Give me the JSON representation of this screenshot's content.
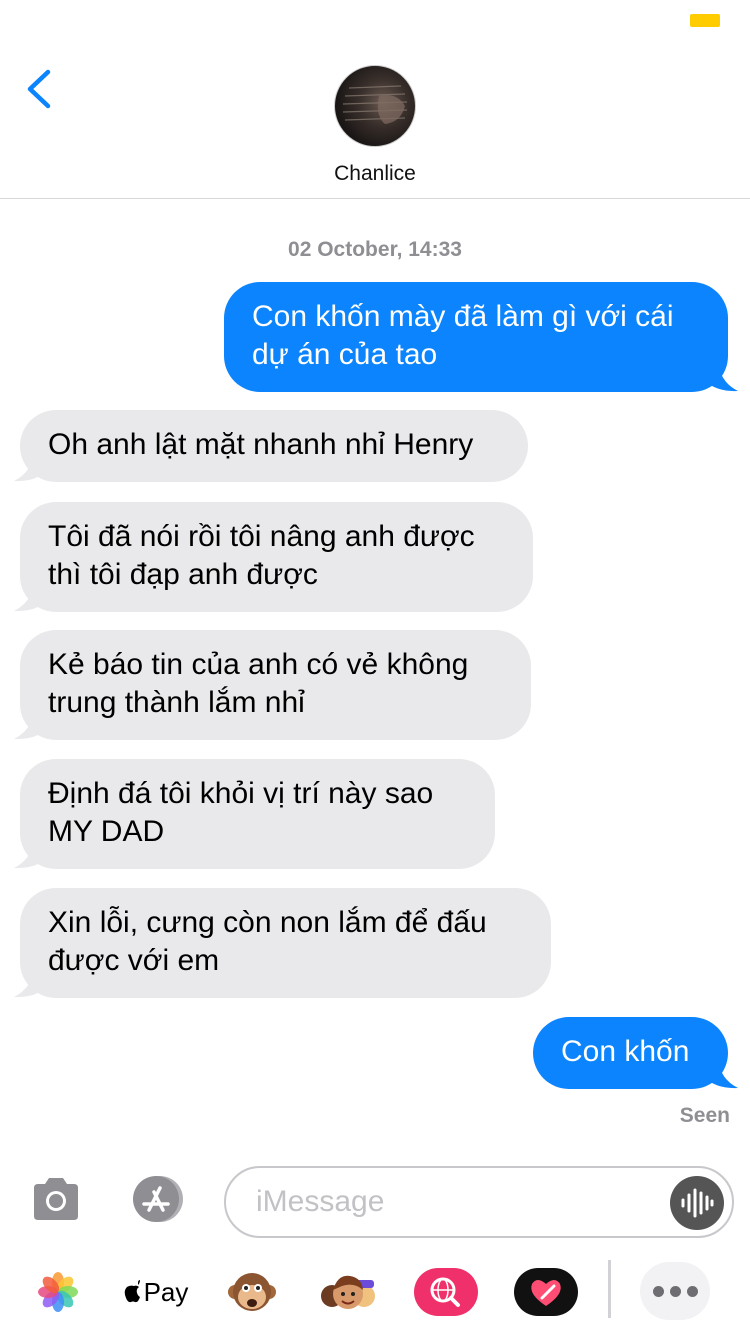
{
  "header": {
    "contact_name": "Chanlice",
    "back_icon": "chevron-left-icon"
  },
  "conversation": {
    "timestamp": "02 October, 14:33",
    "messages": [
      {
        "direction": "out",
        "line1": "Con khốn mày đã làm gì với cái",
        "line2": "dự án của tao"
      },
      {
        "direction": "in",
        "line1": "Oh anh lật mặt nhanh nhỉ Henry",
        "line2": ""
      },
      {
        "direction": "in",
        "line1": "Tôi đã nói rồi tôi nâng anh được",
        "line2": "thì tôi đạp anh được"
      },
      {
        "direction": "in",
        "line1": "Kẻ báo tin của anh có vẻ không",
        "line2": "trung thành lắm nhỉ"
      },
      {
        "direction": "in",
        "line1": "Định đá tôi khỏi vị trí này sao",
        "line2": "MY DAD"
      },
      {
        "direction": "in",
        "line1": "Xin lỗi, cưng còn non lắm để đấu",
        "line2": "được với em"
      },
      {
        "direction": "out",
        "line1": "Con khốn",
        "line2": ""
      }
    ],
    "read_receipt": "Seen"
  },
  "composer": {
    "placeholder": "iMessage",
    "value": ""
  },
  "app_tray": {
    "apple_pay_label": "Pay",
    "items": [
      "photos-icon",
      "apple-pay-icon",
      "animoji-icon",
      "memoji-icon",
      "web-search-icon",
      "digital-touch-icon",
      "more-icon"
    ]
  },
  "colors": {
    "outgoing_bubble": "#0b84fe",
    "incoming_bubble": "#e9e9eb",
    "accent": "#0b84fe",
    "battery": "#ffcc00"
  }
}
